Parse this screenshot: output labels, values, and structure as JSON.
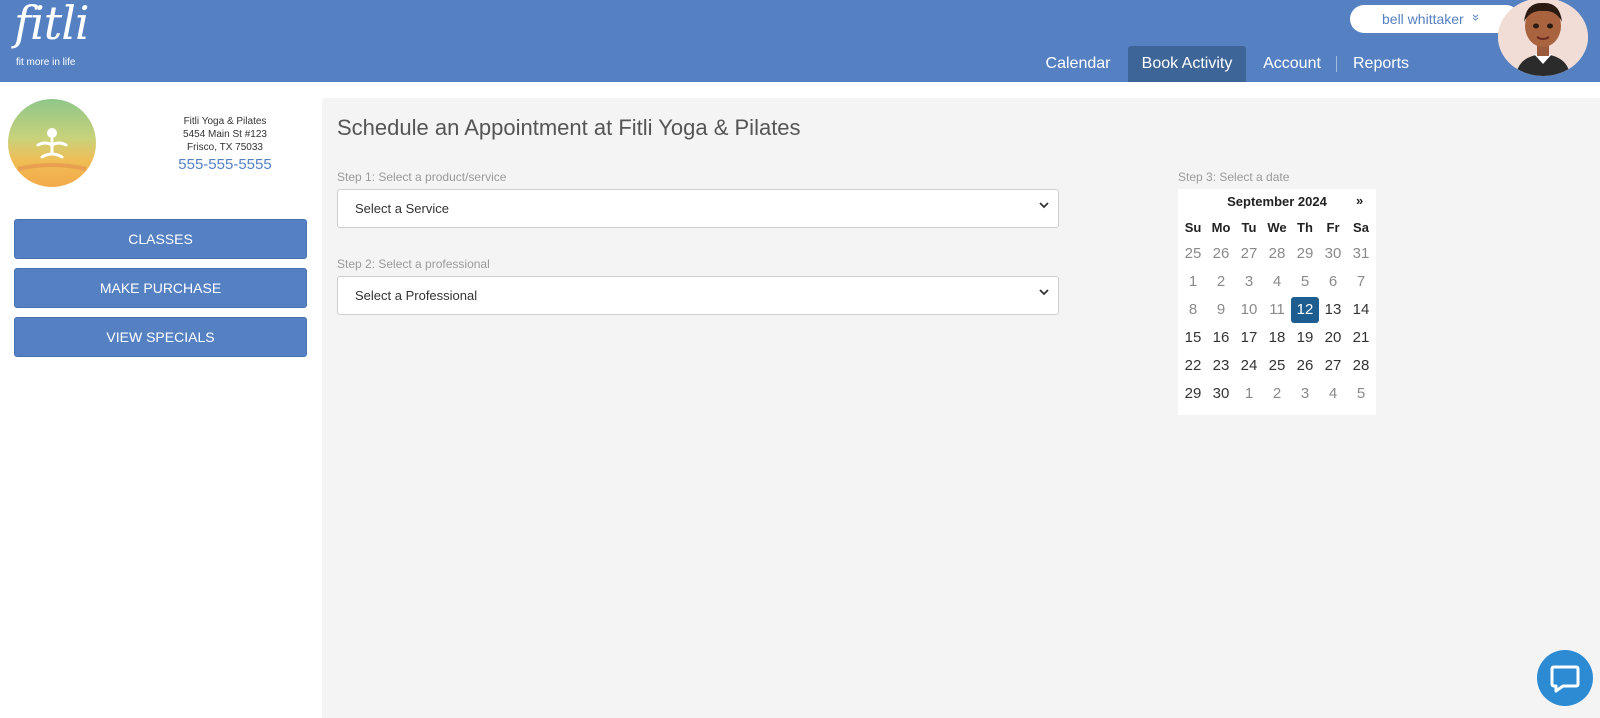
{
  "header": {
    "logo_word": "fitli",
    "logo_tagline": "fit more in life",
    "user_name": "bell whittaker",
    "user_chevron": "»",
    "nav": [
      {
        "label": "Calendar",
        "active": false
      },
      {
        "label": "Book Activity",
        "active": true
      },
      {
        "label": "Account",
        "active": false
      },
      {
        "label": "Reports",
        "active": false
      }
    ]
  },
  "business": {
    "name": "Fitli Yoga & Pilates",
    "address1": "5454 Main St #123",
    "address2": "Frisco, TX 75033",
    "phone": "555-555-5555",
    "logo_text": "FITLI YOGA & PILATES"
  },
  "sidebar": {
    "buttons": [
      "CLASSES",
      "MAKE PURCHASE",
      "VIEW SPECIALS"
    ]
  },
  "main": {
    "title": "Schedule an Appointment at Fitli Yoga & Pilates",
    "step1": {
      "label": "Step 1: Select a product/service",
      "value": "Select a Service"
    },
    "step2": {
      "label": "Step 2: Select a professional",
      "value": "Select a Professional"
    },
    "step3": {
      "label": "Step 3: Select a date"
    }
  },
  "calendar": {
    "month": "September 2024",
    "next": "»",
    "weekdays": [
      "Su",
      "Mo",
      "Tu",
      "We",
      "Th",
      "Fr",
      "Sa"
    ],
    "weeks": [
      [
        "25",
        "26",
        "27",
        "28",
        "29",
        "30",
        "31"
      ],
      [
        "1",
        "2",
        "3",
        "4",
        "5",
        "6",
        "7"
      ],
      [
        "8",
        "9",
        "10",
        "11",
        "12",
        "13",
        "14"
      ],
      [
        "15",
        "16",
        "17",
        "18",
        "19",
        "20",
        "21"
      ],
      [
        "22",
        "23",
        "24",
        "25",
        "26",
        "27",
        "28"
      ],
      [
        "29",
        "30",
        "1",
        "2",
        "3",
        "4",
        "5"
      ]
    ],
    "selected": "12"
  },
  "colors": {
    "brand": "#5581c3",
    "nav_active": "#3e6597",
    "selected_day": "#1d5d90",
    "chat": "#2d8bd3"
  }
}
